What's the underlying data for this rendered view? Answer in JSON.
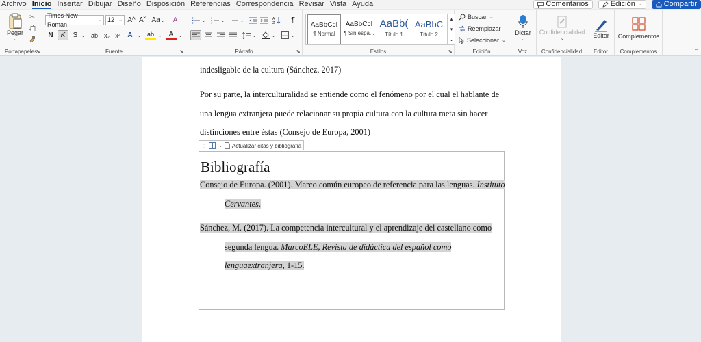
{
  "menu": {
    "tabs": [
      "Archivo",
      "Inicio",
      "Insertar",
      "Dibujar",
      "Diseño",
      "Disposición",
      "Referencias",
      "Correspondencia",
      "Revisar",
      "Vista",
      "Ayuda"
    ],
    "comments_label": "Comentarios",
    "editing_label": "Edición",
    "share_label": "Compartir"
  },
  "ribbon": {
    "clipboard": {
      "paste_label": "Pegar",
      "group_label": "Portapapeles"
    },
    "font": {
      "font_name": "Times New Roman",
      "font_size": "12",
      "group_label": "Fuente",
      "bold": "N",
      "italic": "K",
      "underline": "S",
      "strike": "ab",
      "subscript": "x₂",
      "superscript": "x²",
      "grow": "A^",
      "shrink": "Aˇ",
      "case": "Aa",
      "clear": "A",
      "effects": "A",
      "highlight": "ab",
      "color": "A"
    },
    "paragraph": {
      "group_label": "Párrafo"
    },
    "styles": {
      "group_label": "Estilos",
      "items": [
        {
          "preview": "AaBbCcI",
          "name": "¶ Normal"
        },
        {
          "preview": "AaBbCcI",
          "name": "¶ Sin espa..."
        },
        {
          "preview": "AaBb(",
          "name": "Título 1"
        },
        {
          "preview": "AaBbC",
          "name": "Título 2"
        }
      ]
    },
    "editing": {
      "group_label": "Edición",
      "find": "Buscar",
      "replace": "Reemplazar",
      "select": "Seleccionar"
    },
    "voice": {
      "dictate": "Dictar",
      "group_label": "Voz"
    },
    "sensitivity": {
      "label": "Confidencialidad",
      "group_label": "Confidencialidad"
    },
    "editor": {
      "label": "Editor",
      "group_label": "Editor"
    },
    "addins": {
      "label": "Complementos",
      "group_label": "Complementos"
    }
  },
  "document": {
    "line1": "indesligable de la cultura (Sánchez, 2017)",
    "para2_line1": "Por su parte, la interculturalidad se entiende como el fenómeno por el cual el hablante de",
    "para2_line2": "una lengua extranjera puede relacionar su propia cultura con la cultura meta sin hacer",
    "para2_line3": "distinciones entre éstas (Consejo de Europa, 2001)",
    "update_button": "Actualizar citas y bibliografía",
    "bib_title": "Bibliografía",
    "ref1_a": "Consejo de Europa. (2001). Marco común europeo de referencia para las lenguas. ",
    "ref1_b": "Instituto",
    "ref1_c": "Cervantes",
    "ref1_d": ".",
    "ref2_a": "Sánchez, M. (2017). La competencia intercultural y el aprendizaje del castellano como",
    "ref2_b": "segunda lengua. ",
    "ref2_c": "MarcoELE, Revista de didáctica del español como",
    "ref2_d": "lenguaextranjera",
    "ref2_e": ", 1-15."
  }
}
